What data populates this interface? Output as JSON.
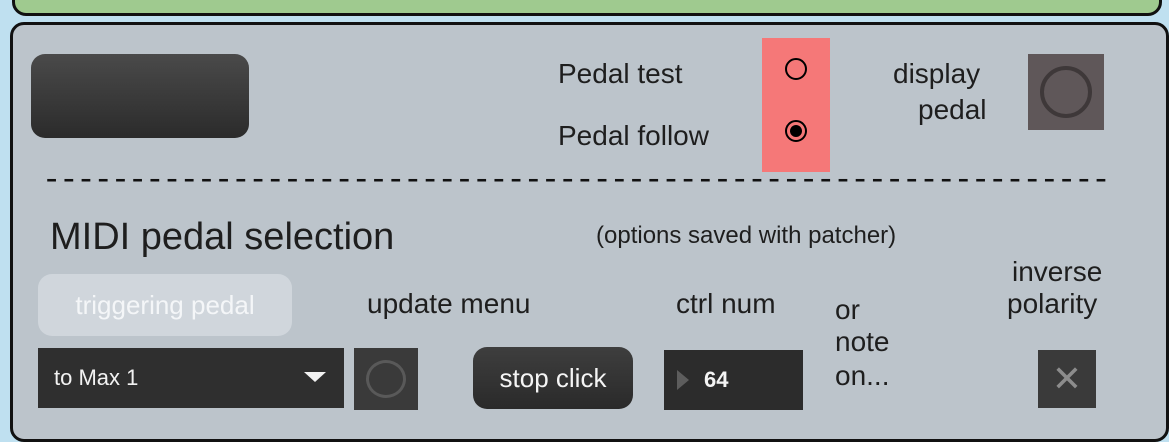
{
  "big_button": {
    "label": ""
  },
  "pedal_mode": {
    "test_label": "Pedal test",
    "follow_label": "Pedal follow",
    "selected": "Pedal follow"
  },
  "display_pedal": {
    "label_line1": "display",
    "label_line2": "pedal"
  },
  "divider": {
    "text": "----------------------------------------------------------------"
  },
  "midi_section": {
    "title": "MIDI pedal selection",
    "note": "(options saved with patcher)"
  },
  "triggering_pedal_button": {
    "label": "triggering pedal"
  },
  "update_menu": {
    "label": "update menu"
  },
  "ctrl_num": {
    "label": "ctrl num",
    "value": "64"
  },
  "note_on": {
    "line1": "or",
    "line2": "note",
    "line3": "on..."
  },
  "inverse_polarity": {
    "line1": "inverse",
    "line2": "polarity",
    "glyph": "✕"
  },
  "midi_menu": {
    "selected": "to Max 1"
  },
  "stop_click_button": {
    "label": "stop click"
  },
  "colors": {
    "panel": "#bcc4cb",
    "top_panel": "#9fca8f",
    "pedal_box": "#f57878",
    "background": "#bfe0f0"
  }
}
